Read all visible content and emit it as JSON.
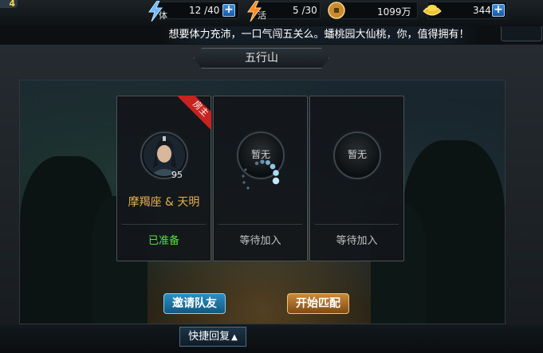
{
  "player": {
    "level_partial": "4"
  },
  "resources": {
    "stamina": {
      "label": "体",
      "value": "12 /40"
    },
    "vitality": {
      "label": "活",
      "value": "5 /30"
    },
    "coins": {
      "value": "1099万"
    },
    "ingots": {
      "value": "344"
    }
  },
  "marquee": "想要体力充沛，一口气闯五关么。蟠桃园大仙桃，你，值得拥有！",
  "title": "五行山",
  "slots": [
    {
      "role_tag": "房主",
      "portrait_text": "",
      "level": "95",
      "name": "摩羯座 & 天明",
      "status": "已准备"
    },
    {
      "portrait_text": "暂无",
      "status": "等待加入"
    },
    {
      "portrait_text": "暂无",
      "status": "等待加入"
    }
  ],
  "buttons": {
    "invite": "邀请队友",
    "start": "开始匹配"
  },
  "quick_recover": "快捷回复",
  "icons": {
    "plus": "plus-icon",
    "stamina": "lightning-icon",
    "vitality": "fire-bolt-icon",
    "coin": "coin-icon",
    "ingot": "gold-ingot-icon",
    "arrow": "arrow-up-icon"
  },
  "colors": {
    "ready": "#55e03a",
    "name": "#e8b04a",
    "host_ribbon": "#c8231f",
    "spinner": "#8fd2ff"
  }
}
